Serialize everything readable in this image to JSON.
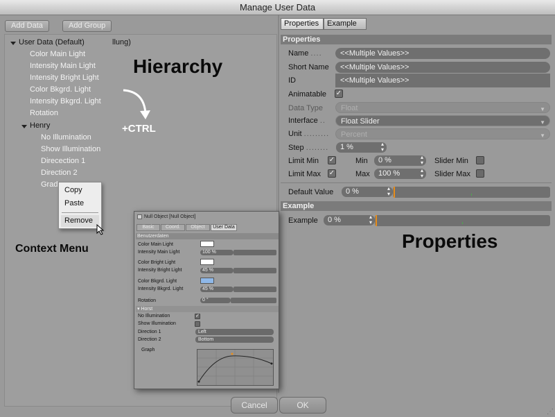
{
  "window": {
    "title": "Manage User Data"
  },
  "toolbar": {
    "add_data": "Add Data",
    "add_group": "Add Group"
  },
  "tree": {
    "root": "User Data (Default)",
    "truncated_text": "llung)",
    "items": [
      "Color Main Light",
      "Intensity Main Light",
      "Intensity Bright Light",
      "Color Bkgrd. Light",
      "Intensity Bkgrd. Light",
      "Rotation"
    ],
    "group": "Henry",
    "group_items": [
      "No Illumination",
      "Show Illumination",
      "Direcection 1",
      "Direction 2",
      "Grad"
    ]
  },
  "annotations": {
    "hierarchy": "Hierarchy",
    "ctrl": "+CTRL",
    "context_menu": "Context Menu",
    "properties": "Properties"
  },
  "context_menu": {
    "items": [
      "Copy",
      "Paste",
      "Remove"
    ]
  },
  "tabs": [
    "Properties",
    "Example"
  ],
  "properties": {
    "section": "Properties",
    "name_label": "Name",
    "name_value": "<<Multiple Values>>",
    "short_name_label": "Short Name",
    "short_name_value": "<<Multiple Values>>",
    "id_label": "ID",
    "id_value": "<<Multiple Values>>",
    "animatable_label": "Animatable",
    "data_type_label": "Data Type",
    "data_type_value": "Float",
    "interface_label": "Interface",
    "interface_value": "Float Slider",
    "unit_label": "Unit",
    "unit_value": "Percent",
    "step_label": "Step",
    "step_value": "1 %",
    "limit_min_label": "Limit Min",
    "min_label": "Min",
    "min_value": "0 %",
    "slider_min_label": "Slider Min",
    "limit_max_label": "Limit Max",
    "max_label": "Max",
    "max_value": "100 %",
    "slider_max_label": "Slider Max",
    "default_value_label": "Default Value",
    "default_value": "0 %"
  },
  "example": {
    "section": "Example",
    "label": "Example",
    "value": "0 %"
  },
  "inset": {
    "title": "Null Object [Null Object]",
    "tabs": [
      "Basic",
      "Coord.",
      "Object",
      "User Data"
    ],
    "section": "Benutzerdaten",
    "color_main": "Color Main Light",
    "intensity_main": "Intensity Main Light",
    "intensity_main_value": "100 %",
    "color_bright": "Color Bright Light",
    "intensity_bright": "Intensity Bright Light",
    "intensity_bright_value": "45 %",
    "color_bkgrd": "Color Bkgrd. Light",
    "intensity_bkgrd": "Intensity Bkgrd. Light",
    "intensity_bkgrd_value": "45 %",
    "rotation": "Rotation",
    "rotation_value": "0 °",
    "group": "Horst",
    "no_illum": "No Illumination",
    "show_illum": "Show Illumination",
    "direction1": "Direction 1",
    "direction1_value": "Left",
    "direction2": "Direction 2",
    "direction2_value": "Bottom",
    "graph": "Graph"
  },
  "footer": {
    "cancel": "Cancel",
    "ok": "OK"
  }
}
